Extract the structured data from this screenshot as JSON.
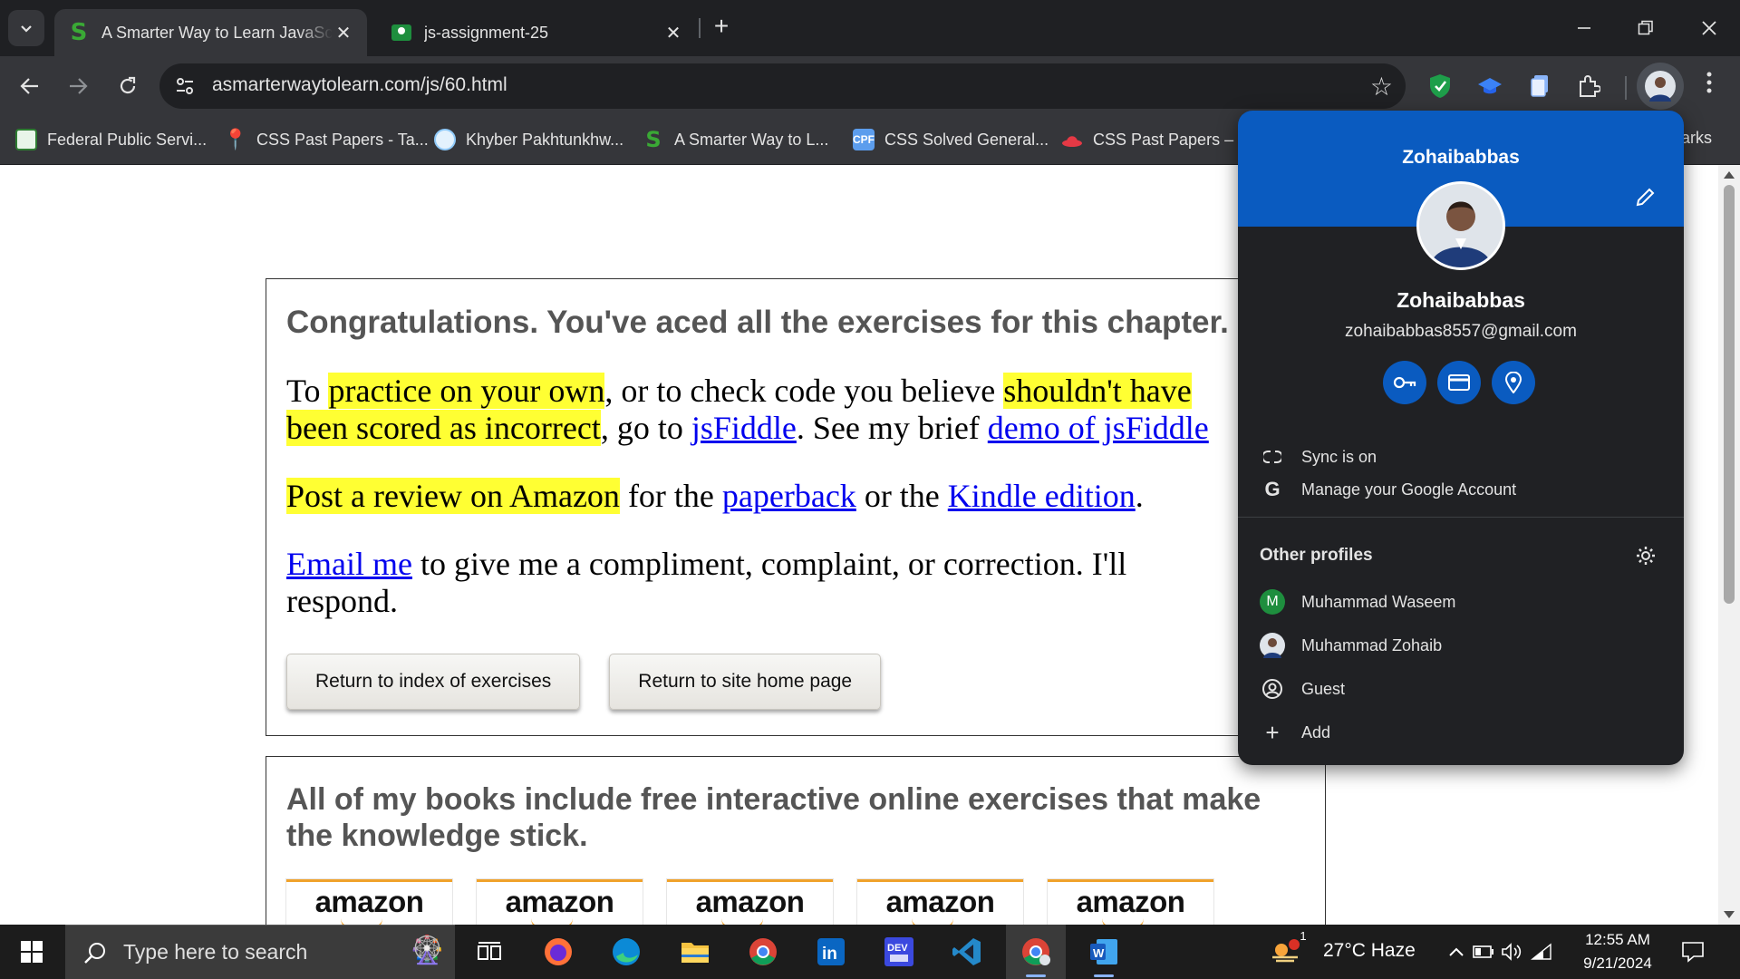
{
  "browser": {
    "tabs": [
      {
        "title": "A Smarter Way to Learn JavaScript",
        "active": true,
        "favicon": "s-logo-icon"
      },
      {
        "title": "js-assignment-25",
        "active": false,
        "favicon": "classroom-icon"
      }
    ],
    "new_tab_symbol": "+",
    "address": "asmarterwaytolearn.com/js/60.html",
    "bookmarks": [
      {
        "label": "Federal Public Servi...",
        "icon": "fpsc-icon",
        "color": "#2e7d32"
      },
      {
        "label": "CSS Past Papers - Ta...",
        "icon": "pin-icon",
        "color": "#d32f2f"
      },
      {
        "label": "Khyber Pakhtunkhw...",
        "icon": "kp-seal-icon",
        "color": "#90caf9"
      },
      {
        "label": "A Smarter Way to L...",
        "icon": "s-logo-icon",
        "color": "#3aa935"
      },
      {
        "label": "CSS Solved General...",
        "icon": "cpf-icon",
        "color": "#5c9ded",
        "icon_text": "CPF"
      },
      {
        "label": "CSS Past Papers – C...",
        "icon": "hat-icon",
        "color": "#e53945"
      }
    ],
    "bookmarks_overflow": "arks"
  },
  "page": {
    "congrats": "Congratulations. You've aced all the exercises for this chapter.",
    "p1": {
      "t1": "To ",
      "h1": "practice on your own",
      "t2": ", or to check code you believe ",
      "h2": "shouldn't have",
      "h3": "been scored as incorrect",
      "t3": ", go to ",
      "link1": "jsFiddle",
      "t4": ". See my brief ",
      "link2": "demo of jsFiddle"
    },
    "p2": {
      "h1": "Post a review on Amazon",
      "t1": " for the ",
      "link1": "paperback",
      "t2": " or the ",
      "link2": "Kindle edition",
      "t3": "."
    },
    "p3": {
      "link1": "Email me",
      "t1": " to give me a compliment, complaint, or correction. I'll",
      "t2": "respond."
    },
    "buttons": {
      "index": "Return to index of exercises",
      "home": "Return to site home page"
    },
    "books_heading": "All of my books include free interactive online exercises that make the knowledge stick.",
    "amazon_logos": [
      "amazon",
      "amazon",
      "amazon",
      "amazon",
      "amazon"
    ]
  },
  "profile_menu": {
    "name_header": "Zohaibabbas",
    "name": "Zohaibabbas",
    "email": "zohaibabbas8557@gmail.com",
    "sync": "Sync is on",
    "manage": "Manage your Google Account",
    "other_profiles_title": "Other profiles",
    "profiles": [
      {
        "label": "Muhammad Waseem",
        "initial": "M",
        "color": "#1e8e3e"
      },
      {
        "label": "Muhammad Zohaib",
        "initial": "",
        "color": "#5f6368"
      }
    ],
    "guest": "Guest",
    "add": "Add"
  },
  "taskbar": {
    "search_placeholder": "Type here to search",
    "weather": "27°C  Haze",
    "weather_badge": "1",
    "time": "12:55 AM",
    "date": "9/21/2024"
  },
  "colors": {
    "highlight": "#ffff33",
    "link": "#0000ee",
    "accent_blue": "#0a5bc0"
  }
}
